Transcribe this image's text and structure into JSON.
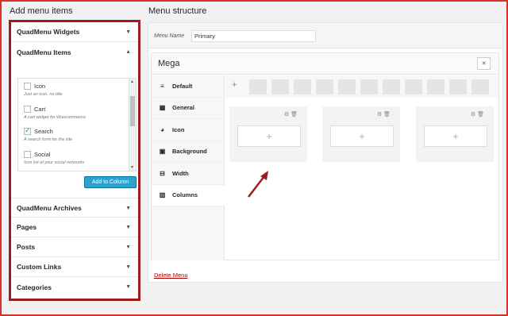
{
  "left": {
    "title": "Add menu items",
    "sections_top": [
      {
        "label": "QuadMenu Widgets",
        "arrow": "▼"
      },
      {
        "label": "QuadMenu Items",
        "arrow": "▲"
      }
    ],
    "items": [
      {
        "label": "Icon",
        "desc": "Just an icon, no title",
        "checked": false
      },
      {
        "label": "Cart",
        "desc": "A cart widget for Woocommerce",
        "checked": false
      },
      {
        "label": "Search",
        "desc": "A search form for the site",
        "checked": true
      },
      {
        "label": "Social",
        "desc": "Icon list of your social networks",
        "checked": false
      }
    ],
    "add_button": "Add to Column",
    "sections_bottom": [
      {
        "label": "QuadMenu Archives",
        "arrow": "▼"
      },
      {
        "label": "Pages",
        "arrow": "▼"
      },
      {
        "label": "Posts",
        "arrow": "▼"
      },
      {
        "label": "Custom Links",
        "arrow": "▼"
      },
      {
        "label": "Categories",
        "arrow": "▼"
      }
    ]
  },
  "right": {
    "title": "Menu structure",
    "menu_name_label": "Menu Name",
    "menu_name_value": "Primary",
    "mega_title": "Mega",
    "close_glyph": "✕",
    "tabs": [
      {
        "label": "Default",
        "icon": "menu-lines-icon",
        "glyph": "≡"
      },
      {
        "label": "General",
        "icon": "settings-grid-icon",
        "glyph": "▦"
      },
      {
        "label": "Icon",
        "icon": "palette-icon",
        "glyph": "◕"
      },
      {
        "label": "Background",
        "icon": "image-icon",
        "glyph": "▣"
      },
      {
        "label": "Width",
        "icon": "width-icon",
        "glyph": "⊟"
      },
      {
        "label": "Columns",
        "icon": "columns-icon",
        "glyph": "▥"
      }
    ],
    "layout_plus": "+",
    "column_plus": "+",
    "column_tools": "⚙ 🗑",
    "delete_link": "Delete Menu"
  },
  "colors": {
    "accent_button": "#2ea2cc",
    "annotation_red": "#a01c1c",
    "delete_link": "#aa0000"
  }
}
